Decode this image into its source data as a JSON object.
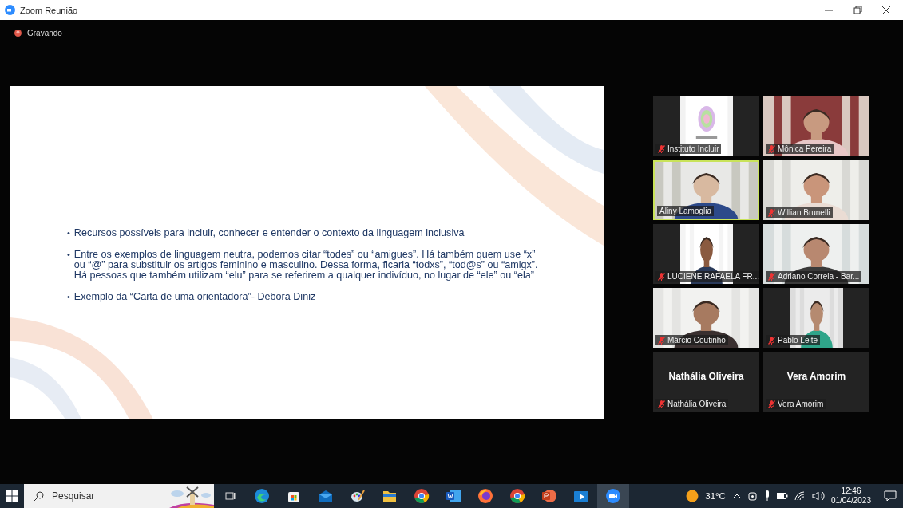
{
  "window": {
    "title": "Zoom Reunião"
  },
  "recording": {
    "label": "Gravando"
  },
  "slide": {
    "bullet_char": "•",
    "bullets": [
      "Recursos possíveis para incluir, conhecer e entender o contexto da linguagem inclusiva",
      "Entre os exemplos de linguagem neutra, podemos citar “todes” ou “amigues”. Há também quem use “x” ou “@” para substituir os artigos feminino e masculino. Dessa forma, ficaria “todxs”, “tod@s” ou “amigx”. Há pessoas que também utilizam “elu” para se referirem a qualquer indivíduo, no lugar de “ele” ou “ela”",
      "Exemplo da “Carta de uma orientadora”- Debora Diniz"
    ]
  },
  "participants": [
    {
      "kind": "portrait",
      "name": "Instituto Incluir",
      "muted": true,
      "speaking": false
    },
    {
      "kind": "video",
      "name": "Mônica Pereira",
      "muted": true,
      "speaking": false
    },
    {
      "kind": "video",
      "name": "Aliny Lamoglia",
      "muted": false,
      "speaking": true
    },
    {
      "kind": "video",
      "name": "Willian Brunelli",
      "muted": true,
      "speaking": false
    },
    {
      "kind": "portrait",
      "name": "LUCIENE RAFAELA FR...",
      "muted": true,
      "speaking": false
    },
    {
      "kind": "video",
      "name": "Adriano Correia - Bar...",
      "muted": true,
      "speaking": false
    },
    {
      "kind": "video",
      "name": "Márcio Coutinho",
      "muted": true,
      "speaking": false
    },
    {
      "kind": "portrait",
      "name": "Pablo Leite",
      "muted": true,
      "speaking": false
    },
    {
      "kind": "name",
      "display_name": "Nathália Oliveira",
      "name": "Nathália Oliveira",
      "muted": true,
      "speaking": false
    },
    {
      "kind": "name",
      "display_name": "Vera Amorim",
      "name": "Vera Amorim",
      "muted": true,
      "speaking": false
    }
  ],
  "taskbar": {
    "search": {
      "placeholder": "Pesquisar"
    },
    "apps": [
      {
        "kind": "taskview",
        "selected": false
      },
      {
        "kind": "edge",
        "selected": false
      },
      {
        "kind": "store",
        "selected": false
      },
      {
        "kind": "mail",
        "selected": false
      },
      {
        "kind": "paint",
        "selected": false
      },
      {
        "kind": "folder",
        "selected": false
      },
      {
        "kind": "chrome",
        "selected": false
      },
      {
        "kind": "word",
        "selected": false
      },
      {
        "kind": "firefox",
        "selected": false
      },
      {
        "kind": "chrome",
        "selected": false
      },
      {
        "kind": "powerpoint",
        "selected": false
      },
      {
        "kind": "video",
        "selected": false
      },
      {
        "kind": "zoom",
        "selected": true
      }
    ],
    "weather": "31°C",
    "time": "12:46",
    "date": "01/04/2023"
  }
}
